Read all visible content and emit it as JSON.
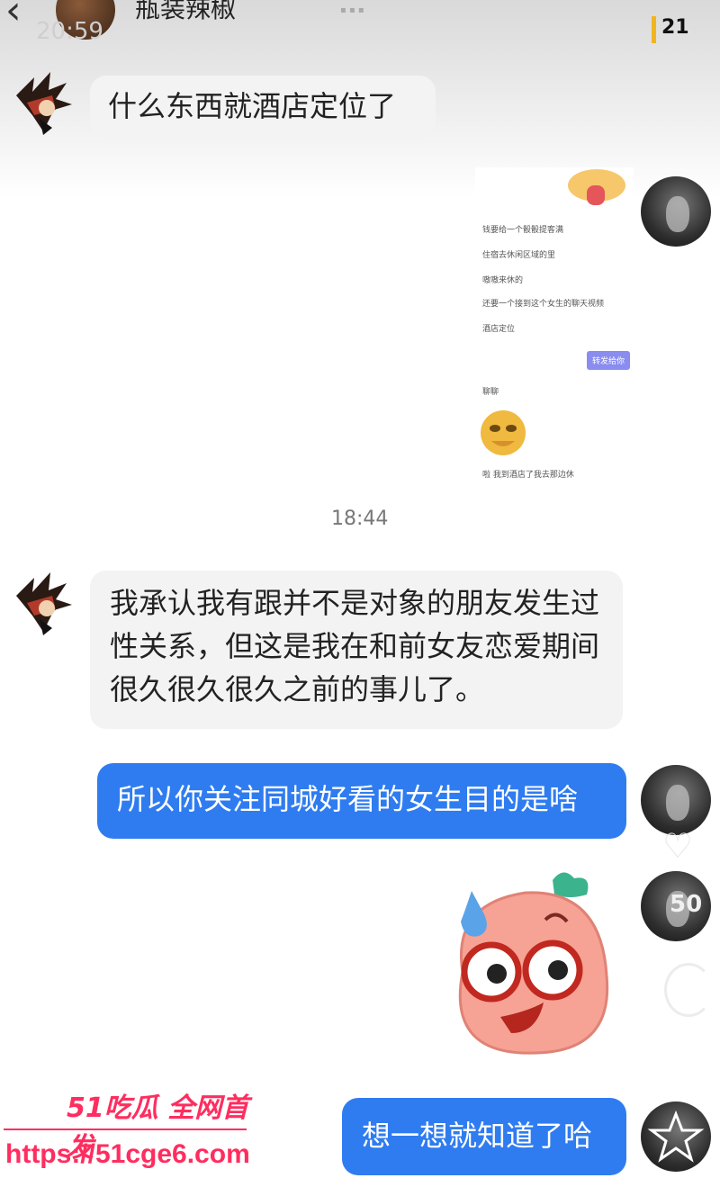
{
  "header": {
    "title": "瓶装辣椒",
    "unread_count": "21",
    "time_faint": "20:59"
  },
  "messages": {
    "m1": "什么东西就酒店定位了",
    "timestamp": "18:44",
    "m2": "我承认我有跟并不是对象的朋友发生过性关系，但这是我在和前女友恋爱期间很久很久很久之前的事儿了。",
    "m3": "所以你关注同城好看的女生目的是啥",
    "m4": "想一想就知道了哈"
  },
  "screenshot": {
    "lines": [
      "钱要给一个骰骰提客满",
      "住宿去休闲区域的里",
      "嗷嗷来休的",
      "还要一个接到这个女生的聊天视频",
      "酒店定位",
      "聊聊",
      "啦 我到酒店了我去那边休"
    ],
    "tag": "转发给你"
  },
  "overlay": {
    "count_faint": "50"
  },
  "watermark": {
    "top": "51吃瓜 全网首发",
    "url": "https://51cge6.com"
  }
}
